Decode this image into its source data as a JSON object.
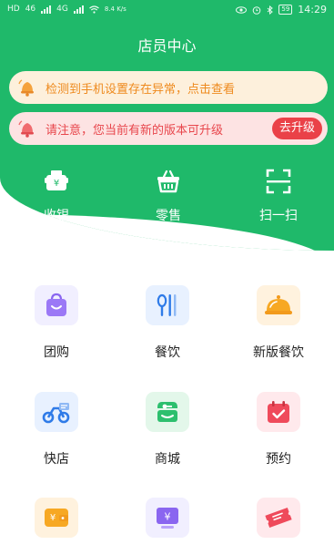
{
  "status_bar": {
    "left_labels": [
      "HD",
      "46",
      "4G"
    ],
    "network_speed": "8.4 K/s",
    "battery": "59",
    "time": "14:29"
  },
  "header": {
    "title": "店员中心"
  },
  "notices": {
    "warning_text": "检测到手机设置存在异常，点击查看",
    "update_text": "请注意，您当前有新的版本可升级",
    "upgrade_button": "去升级"
  },
  "quick_actions": [
    {
      "label": "收银",
      "icon": "cash-register-icon"
    },
    {
      "label": "零售",
      "icon": "basket-icon"
    },
    {
      "label": "扫一扫",
      "icon": "scan-icon"
    }
  ],
  "grid": [
    {
      "label": "团购",
      "icon": "shopping-bag-icon"
    },
    {
      "label": "餐饮",
      "icon": "utensils-icon"
    },
    {
      "label": "新版餐饮",
      "icon": "food-cloche-icon"
    },
    {
      "label": "快店",
      "icon": "delivery-bike-icon"
    },
    {
      "label": "商城",
      "icon": "mall-store-icon"
    },
    {
      "label": "预约",
      "icon": "calendar-check-icon"
    },
    {
      "label": "",
      "icon": "wallet-icon"
    },
    {
      "label": "",
      "icon": "yen-screen-icon"
    },
    {
      "label": "",
      "icon": "ticket-icon"
    }
  ],
  "colors": {
    "brand_green": "#1fb96a",
    "warning_orange": "#ee8a1e",
    "alert_red": "#e8464c"
  }
}
